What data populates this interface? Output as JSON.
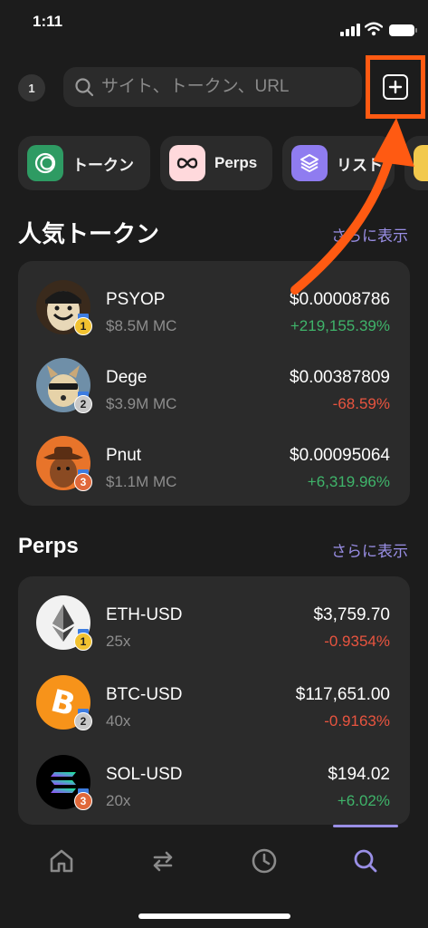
{
  "status_bar": {
    "time": "1:11"
  },
  "browser": {
    "tab_count": "1",
    "search_placeholder": "サイト、トークン、URL",
    "new_tab_icon": "plus-square-icon",
    "highlight_color": "#ff5a12"
  },
  "categories": [
    {
      "label": "トークン",
      "icon": "token-icon",
      "color": "#2e9b63"
    },
    {
      "label": "Perps",
      "icon": "infinity-icon",
      "color": "#ffd9dc"
    },
    {
      "label": "リスト",
      "icon": "layers-icon",
      "color": "#8f7cf0"
    },
    {
      "label": "",
      "icon": "chart-icon",
      "color": "#f2c94c"
    }
  ],
  "popular_tokens": {
    "title": "人気トークン",
    "more_label": "さらに表示",
    "items": [
      {
        "name": "PSYOP",
        "sub": "$8.5M MC",
        "price": "$0.00008786",
        "change": "+219,155.39%",
        "direction": "up",
        "rank": "1",
        "avatar_icon": "psyop-avatar"
      },
      {
        "name": "Dege",
        "sub": "$3.9M MC",
        "price": "$0.00387809",
        "change": "-68.59%",
        "direction": "down",
        "rank": "2",
        "avatar_icon": "dege-avatar"
      },
      {
        "name": "Pnut",
        "sub": "$1.1M MC",
        "price": "$0.00095064",
        "change": "+6,319.96%",
        "direction": "up",
        "rank": "3",
        "avatar_icon": "pnut-avatar"
      }
    ]
  },
  "perps": {
    "title": "Perps",
    "more_label": "さらに表示",
    "items": [
      {
        "name": "ETH-USD",
        "sub": "25x",
        "price": "$3,759.70",
        "change": "-0.9354%",
        "direction": "down",
        "rank": "1",
        "avatar_icon": "ethereum-icon"
      },
      {
        "name": "BTC-USD",
        "sub": "40x",
        "price": "$117,651.00",
        "change": "-0.9163%",
        "direction": "down",
        "rank": "2",
        "avatar_icon": "bitcoin-icon"
      },
      {
        "name": "SOL-USD",
        "sub": "20x",
        "price": "$194.02",
        "change": "+6.02%",
        "direction": "up",
        "rank": "3",
        "avatar_icon": "solana-icon"
      }
    ]
  },
  "bottom_nav": [
    {
      "icon": "home-icon",
      "active": false
    },
    {
      "icon": "swap-icon",
      "active": false
    },
    {
      "icon": "clock-icon",
      "active": false
    },
    {
      "icon": "search-icon",
      "active": true
    }
  ],
  "colors": {
    "background": "#1c1c1c",
    "card": "#2b2b2b",
    "accent": "#9a8fe6",
    "positive": "#3fb46a",
    "negative": "#e8543f"
  }
}
